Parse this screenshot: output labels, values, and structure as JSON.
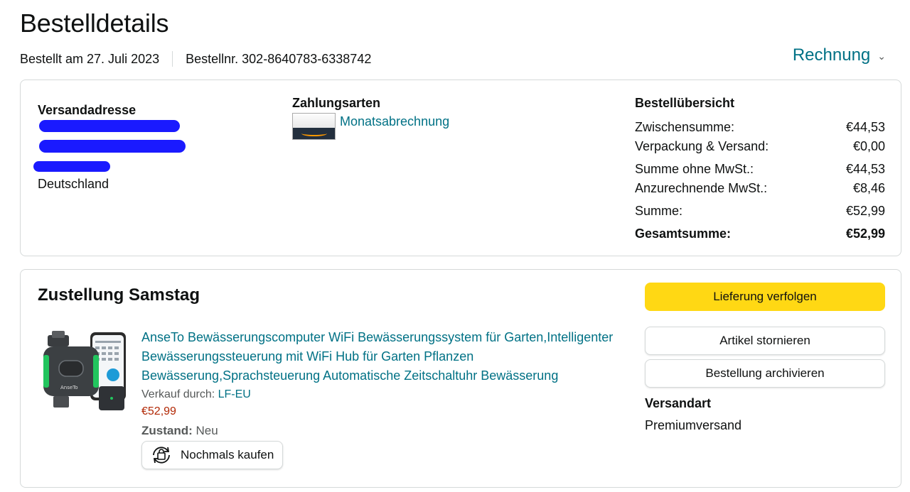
{
  "header": {
    "title": "Bestelldetails",
    "order_date": "Bestellt am 27. Juli 2023",
    "order_number": "Bestellnr. 302-8640783-6338742",
    "invoice_label": "Rechnung"
  },
  "shipping_address": {
    "title": "Versandadresse",
    "country": "Deutschland"
  },
  "payment": {
    "title": "Zahlungsarten",
    "method": "Monatsabrechnung"
  },
  "summary": {
    "title": "Bestellübersicht",
    "rows": [
      {
        "label": "Zwischensumme:",
        "value": "€44,53"
      },
      {
        "label": "Verpackung & Versand:",
        "value": "€0,00"
      },
      {
        "label": "Summe ohne MwSt.:",
        "value": "€44,53"
      },
      {
        "label": "Anzurechnende MwSt.:",
        "value": "€8,46"
      },
      {
        "label": "Summe:",
        "value": "€52,99"
      },
      {
        "label": "Gesamtsumme:",
        "value": "€52,99"
      }
    ]
  },
  "delivery": {
    "title": "Zustellung Samstag",
    "product_title": "AnseTo Bewässerungscomputer WiFi Bewässerungssystem für Garten,Intelligenter Bewässerungssteuerung mit WiFi Hub für Garten Pflanzen Bewässerung,Sprachsteuerung Automatische Zeitschaltuhr Bewässerung",
    "seller_prefix": "Verkauf durch:",
    "seller_name": "LF-EU",
    "price": "€52,99",
    "condition_label": "Zustand:",
    "condition_value": "Neu",
    "buy_again_label": "Nochmals kaufen",
    "track_button": "Lieferung verfolgen",
    "cancel_button": "Artikel stornieren",
    "archive_button": "Bestellung archivieren",
    "shipping_method_label": "Versandart",
    "shipping_method_value": "Premiumversand"
  },
  "colors": {
    "link": "#007185",
    "price": "#b12704",
    "primary_button": "#ffd814",
    "redaction": "#1a1aff"
  }
}
